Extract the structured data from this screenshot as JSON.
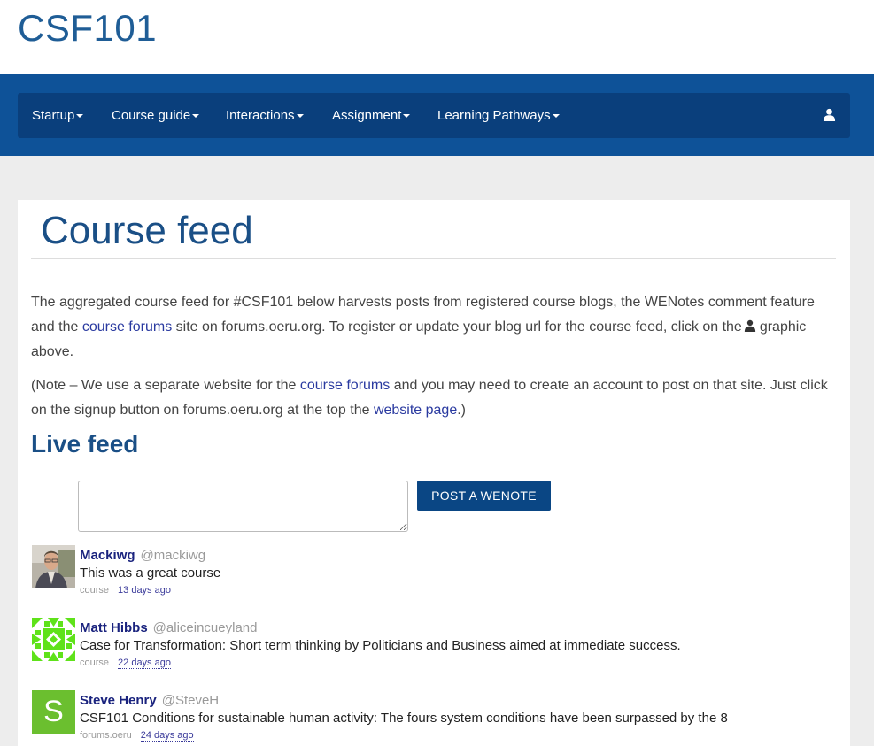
{
  "site": {
    "title": "CSF101"
  },
  "nav": {
    "items": [
      {
        "label": "Startup"
      },
      {
        "label": "Course guide"
      },
      {
        "label": "Interactions"
      },
      {
        "label": "Assignment"
      },
      {
        "label": "Learning Pathways"
      }
    ],
    "user_icon": "user-icon"
  },
  "page": {
    "title": "Course feed",
    "intro": {
      "part1": "The aggregated course feed for #CSF101 below harvests posts from registered course blogs, the WENotes comment feature and the ",
      "link1": "course forums",
      "part2": " site on forums.oeru.org. To register or update your blog url for the course feed, click on the",
      "part3": "graphic above."
    },
    "note": {
      "part1": "(Note – We use a separate website for the ",
      "link1": "course forums",
      "part2": " and you may need to create an account to post on that site. Just click on the signup button on forums.oeru.org at the top the ",
      "link2": "website page",
      "part3": ".)"
    },
    "live_feed_heading": "Live feed",
    "post_button": "POST A WENOTE",
    "note_input_value": ""
  },
  "feed": [
    {
      "name": "Mackiwg",
      "handle": "@mackiwg",
      "text": "This was a great course",
      "source": "course",
      "ago": "13 days ago",
      "avatar": "photo-avatar"
    },
    {
      "name": "Matt Hibbs",
      "handle": "@aliceincueyland",
      "text": "Case for Transformation: Short term thinking by Politicians and Business aimed at immediate success.",
      "source": "course",
      "ago": "22 days ago",
      "avatar": "pattern-avatar"
    },
    {
      "name": "Steve Henry",
      "handle": "@SteveH",
      "text": "CSF101 Conditions for sustainable human activity: The fours system conditions have been surpassed by the 8",
      "source": "forums.oeru",
      "ago": "24 days ago",
      "avatar": "letter-avatar",
      "avatar_letter": "S"
    }
  ],
  "colors": {
    "brand_blue": "#0e5298",
    "navbar": "#0a3f7c",
    "title_blue": "#1a4f86",
    "link": "#2a3aa0",
    "avatar_green": "#6bbf2f"
  }
}
